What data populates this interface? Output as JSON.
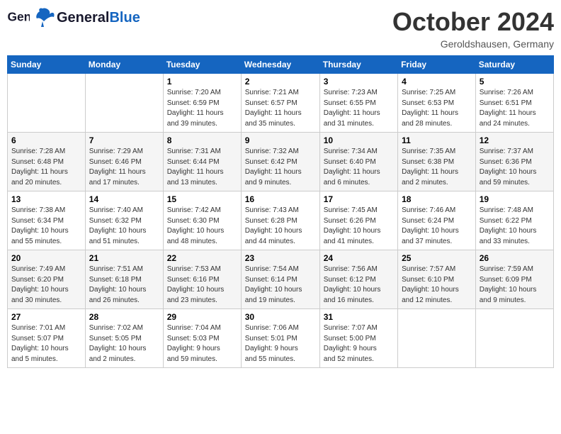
{
  "header": {
    "logo_general": "General",
    "logo_blue": "Blue",
    "month": "October 2024",
    "location": "Geroldshausen, Germany"
  },
  "weekdays": [
    "Sunday",
    "Monday",
    "Tuesday",
    "Wednesday",
    "Thursday",
    "Friday",
    "Saturday"
  ],
  "weeks": [
    [
      {
        "day": "",
        "info": ""
      },
      {
        "day": "",
        "info": ""
      },
      {
        "day": "1",
        "info": "Sunrise: 7:20 AM\nSunset: 6:59 PM\nDaylight: 11 hours\nand 39 minutes."
      },
      {
        "day": "2",
        "info": "Sunrise: 7:21 AM\nSunset: 6:57 PM\nDaylight: 11 hours\nand 35 minutes."
      },
      {
        "day": "3",
        "info": "Sunrise: 7:23 AM\nSunset: 6:55 PM\nDaylight: 11 hours\nand 31 minutes."
      },
      {
        "day": "4",
        "info": "Sunrise: 7:25 AM\nSunset: 6:53 PM\nDaylight: 11 hours\nand 28 minutes."
      },
      {
        "day": "5",
        "info": "Sunrise: 7:26 AM\nSunset: 6:51 PM\nDaylight: 11 hours\nand 24 minutes."
      }
    ],
    [
      {
        "day": "6",
        "info": "Sunrise: 7:28 AM\nSunset: 6:48 PM\nDaylight: 11 hours\nand 20 minutes."
      },
      {
        "day": "7",
        "info": "Sunrise: 7:29 AM\nSunset: 6:46 PM\nDaylight: 11 hours\nand 17 minutes."
      },
      {
        "day": "8",
        "info": "Sunrise: 7:31 AM\nSunset: 6:44 PM\nDaylight: 11 hours\nand 13 minutes."
      },
      {
        "day": "9",
        "info": "Sunrise: 7:32 AM\nSunset: 6:42 PM\nDaylight: 11 hours\nand 9 minutes."
      },
      {
        "day": "10",
        "info": "Sunrise: 7:34 AM\nSunset: 6:40 PM\nDaylight: 11 hours\nand 6 minutes."
      },
      {
        "day": "11",
        "info": "Sunrise: 7:35 AM\nSunset: 6:38 PM\nDaylight: 11 hours\nand 2 minutes."
      },
      {
        "day": "12",
        "info": "Sunrise: 7:37 AM\nSunset: 6:36 PM\nDaylight: 10 hours\nand 59 minutes."
      }
    ],
    [
      {
        "day": "13",
        "info": "Sunrise: 7:38 AM\nSunset: 6:34 PM\nDaylight: 10 hours\nand 55 minutes."
      },
      {
        "day": "14",
        "info": "Sunrise: 7:40 AM\nSunset: 6:32 PM\nDaylight: 10 hours\nand 51 minutes."
      },
      {
        "day": "15",
        "info": "Sunrise: 7:42 AM\nSunset: 6:30 PM\nDaylight: 10 hours\nand 48 minutes."
      },
      {
        "day": "16",
        "info": "Sunrise: 7:43 AM\nSunset: 6:28 PM\nDaylight: 10 hours\nand 44 minutes."
      },
      {
        "day": "17",
        "info": "Sunrise: 7:45 AM\nSunset: 6:26 PM\nDaylight: 10 hours\nand 41 minutes."
      },
      {
        "day": "18",
        "info": "Sunrise: 7:46 AM\nSunset: 6:24 PM\nDaylight: 10 hours\nand 37 minutes."
      },
      {
        "day": "19",
        "info": "Sunrise: 7:48 AM\nSunset: 6:22 PM\nDaylight: 10 hours\nand 33 minutes."
      }
    ],
    [
      {
        "day": "20",
        "info": "Sunrise: 7:49 AM\nSunset: 6:20 PM\nDaylight: 10 hours\nand 30 minutes."
      },
      {
        "day": "21",
        "info": "Sunrise: 7:51 AM\nSunset: 6:18 PM\nDaylight: 10 hours\nand 26 minutes."
      },
      {
        "day": "22",
        "info": "Sunrise: 7:53 AM\nSunset: 6:16 PM\nDaylight: 10 hours\nand 23 minutes."
      },
      {
        "day": "23",
        "info": "Sunrise: 7:54 AM\nSunset: 6:14 PM\nDaylight: 10 hours\nand 19 minutes."
      },
      {
        "day": "24",
        "info": "Sunrise: 7:56 AM\nSunset: 6:12 PM\nDaylight: 10 hours\nand 16 minutes."
      },
      {
        "day": "25",
        "info": "Sunrise: 7:57 AM\nSunset: 6:10 PM\nDaylight: 10 hours\nand 12 minutes."
      },
      {
        "day": "26",
        "info": "Sunrise: 7:59 AM\nSunset: 6:09 PM\nDaylight: 10 hours\nand 9 minutes."
      }
    ],
    [
      {
        "day": "27",
        "info": "Sunrise: 7:01 AM\nSunset: 5:07 PM\nDaylight: 10 hours\nand 5 minutes."
      },
      {
        "day": "28",
        "info": "Sunrise: 7:02 AM\nSunset: 5:05 PM\nDaylight: 10 hours\nand 2 minutes."
      },
      {
        "day": "29",
        "info": "Sunrise: 7:04 AM\nSunset: 5:03 PM\nDaylight: 9 hours\nand 59 minutes."
      },
      {
        "day": "30",
        "info": "Sunrise: 7:06 AM\nSunset: 5:01 PM\nDaylight: 9 hours\nand 55 minutes."
      },
      {
        "day": "31",
        "info": "Sunrise: 7:07 AM\nSunset: 5:00 PM\nDaylight: 9 hours\nand 52 minutes."
      },
      {
        "day": "",
        "info": ""
      },
      {
        "day": "",
        "info": ""
      }
    ]
  ]
}
